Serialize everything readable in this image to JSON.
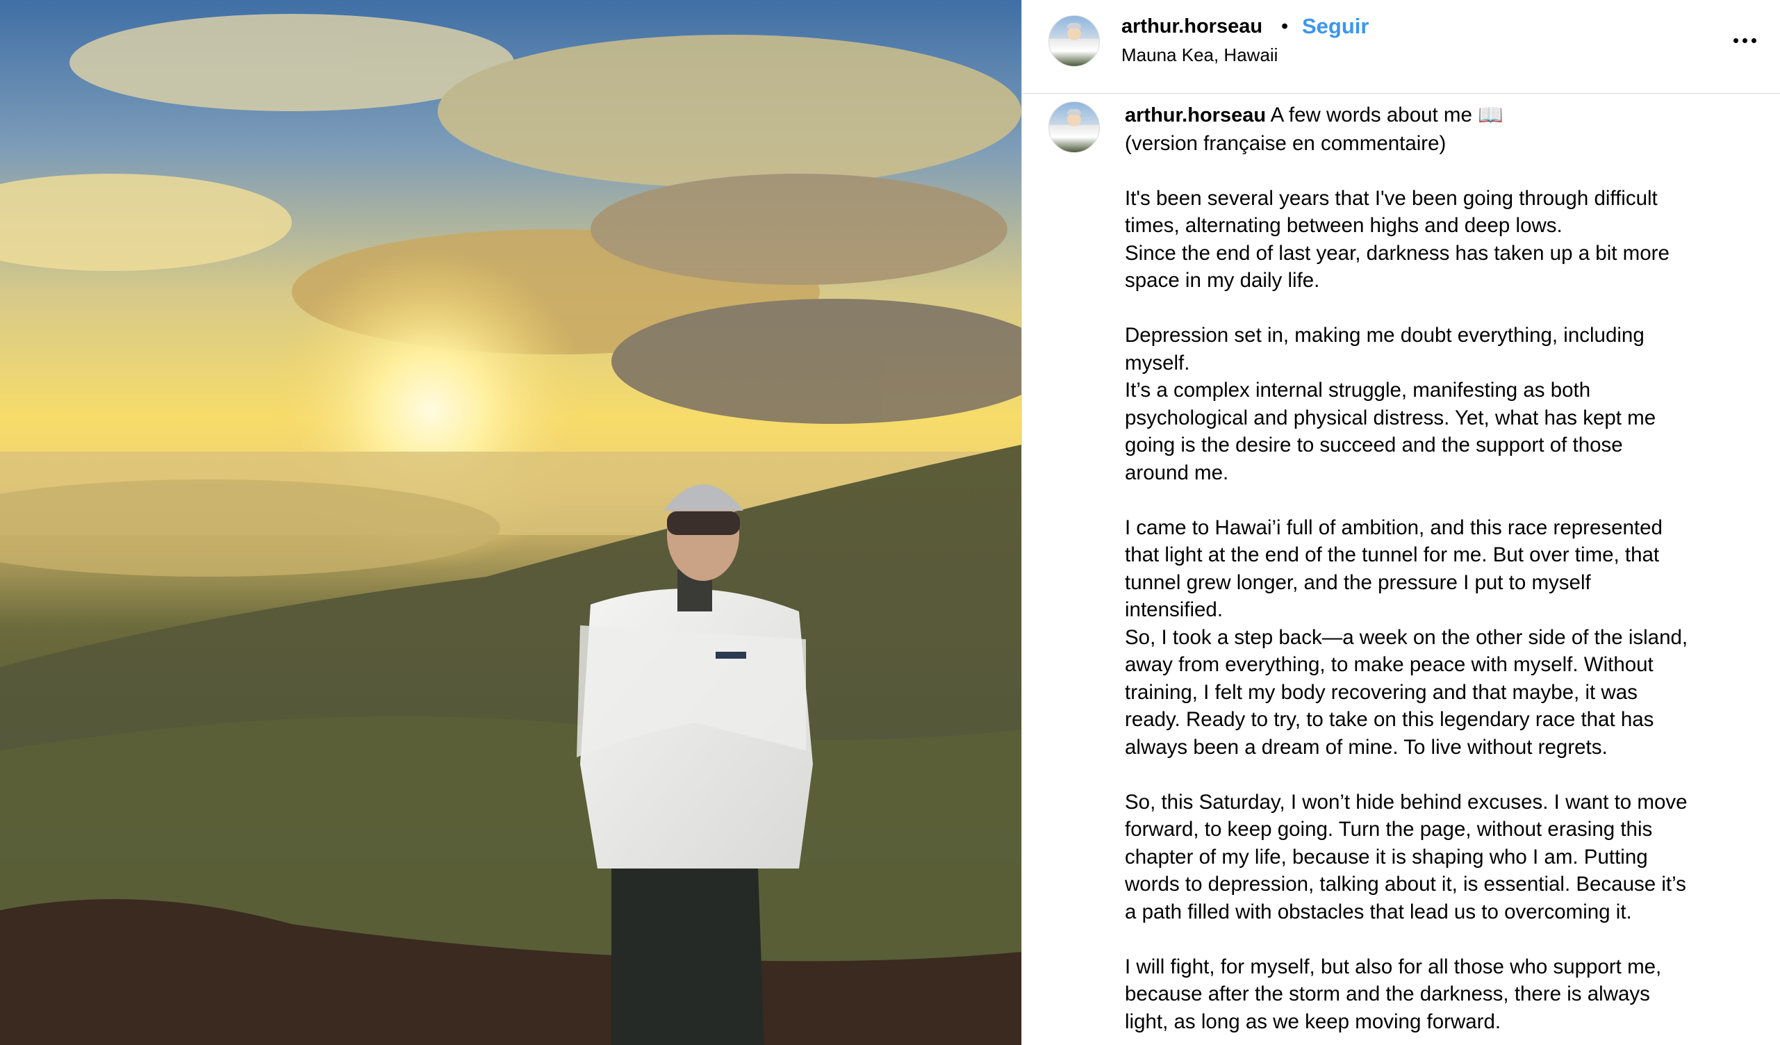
{
  "post": {
    "username": "arthur.horseau",
    "separator": "•",
    "follow_label": "Seguir",
    "location": "Mauna Kea, Hawaii",
    "more_icon": "more-horizontal-icon",
    "photo_description_logo": "Columbia"
  },
  "caption": {
    "username": "arthur.horseau",
    "first_line": "A few words about me 📖",
    "paragraphs": [
      [
        "(version française en commentaire)"
      ],
      [
        "It's been several years that I've been going through difficult",
        "times, alternating between highs and deep lows.",
        "Since the end of last year, darkness has taken up a bit more",
        "space in my daily life."
      ],
      [
        "Depression set in, making me doubt everything, including",
        "myself.",
        "It’s a complex internal struggle, manifesting as both",
        "psychological and physical distress. Yet, what has kept me",
        "going is the desire to succeed and the support of those",
        "around me."
      ],
      [
        "I came to Hawai’i full of ambition, and this race represented",
        "that light at the end of the tunnel for me. But over time, that",
        "tunnel grew longer, and the pressure I put to myself",
        "intensified.",
        "So, I took a step back—a week on the other side of the island,",
        "away from everything, to make peace with myself. Without",
        "training, I felt my body recovering and that maybe, it was",
        "ready. Ready to try, to take on this legendary race that has",
        "always been a dream of mine. To live without regrets."
      ],
      [
        "So, this Saturday, I won’t hide behind excuses. I want to move",
        "forward, to keep going. Turn the page, without erasing this",
        "chapter of my life, because it is shaping who I am. Putting",
        "words to depression, talking about it, is essential. Because it’s",
        "a path filled with obstacles that lead us to overcoming it."
      ],
      [
        "I will fight, for myself, but also for all those who support me,",
        "because after the storm and the darkness, there is always",
        "light, as long as we keep moving forward."
      ]
    ]
  }
}
